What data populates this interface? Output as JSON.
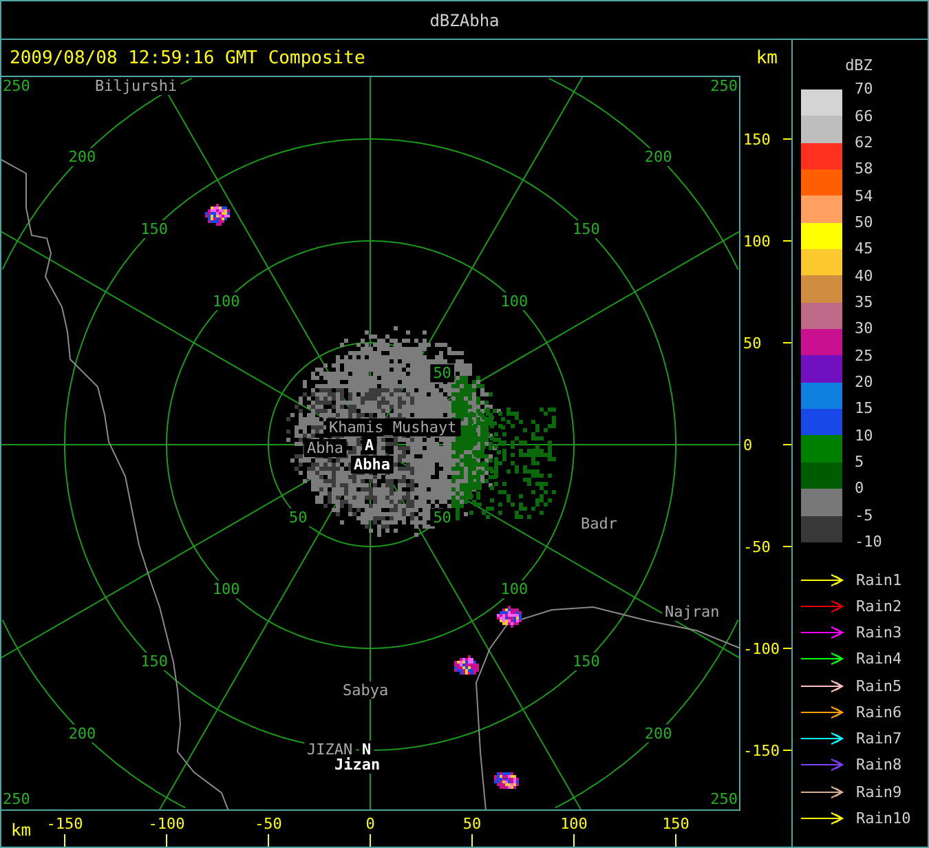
{
  "window": {
    "title": "dBZAbha"
  },
  "header": {
    "timestamp": "2009/08/08 12:59:16 GMT Composite",
    "unit": "km"
  },
  "range_rings": [
    {
      "labels": [
        "50",
        "50",
        "50"
      ]
    },
    {
      "labels": [
        "100",
        "100",
        "100",
        "100"
      ]
    },
    {
      "labels": [
        "150",
        "150",
        "150",
        "150"
      ]
    },
    {
      "labels": [
        "200",
        "200",
        "200",
        "200"
      ]
    },
    {
      "labels": [
        "250",
        "250",
        "250",
        "250"
      ]
    }
  ],
  "places": [
    {
      "name": "Biljurshi",
      "kind": "town"
    },
    {
      "name": "Khamis_Mushayt",
      "kind": "town"
    },
    {
      "name": "Abha",
      "kind": "town"
    },
    {
      "name": "A",
      "kind": "marker"
    },
    {
      "name": "Abha",
      "kind": "site"
    },
    {
      "name": "Badr",
      "kind": "town"
    },
    {
      "name": "Najran",
      "kind": "town"
    },
    {
      "name": "Sabya",
      "kind": "town"
    },
    {
      "name": "JIZAN",
      "kind": "town"
    },
    {
      "name": "N",
      "kind": "marker"
    },
    {
      "name": "Jizan",
      "kind": "site"
    }
  ],
  "y_axis": {
    "ticks": [
      "150",
      "100",
      "50",
      "0",
      "-50",
      "-100",
      "-150"
    ]
  },
  "x_axis": {
    "unit": "km",
    "ticks": [
      "-150",
      "-100",
      "-50",
      "0",
      "50",
      "100",
      "150"
    ]
  },
  "scale": {
    "title": "dBZ",
    "bins": [
      {
        "color": "#d4d4d4"
      },
      {
        "color": "#bebebe"
      },
      {
        "color": "#ff3020"
      },
      {
        "color": "#ff5f00"
      },
      {
        "color": "#ff9f60"
      },
      {
        "color": "#ffff00"
      },
      {
        "color": "#fcc830"
      },
      {
        "color": "#d08c40"
      },
      {
        "color": "#c06a8a"
      },
      {
        "color": "#c81090"
      },
      {
        "color": "#7010c0"
      },
      {
        "color": "#1080e0"
      },
      {
        "color": "#1848e8"
      },
      {
        "color": "#008000"
      },
      {
        "color": "#005c00"
      },
      {
        "color": "#787878"
      },
      {
        "color": "#383838"
      }
    ],
    "labels": [
      "70",
      "66",
      "62",
      "58",
      "54",
      "50",
      "45",
      "40",
      "35",
      "30",
      "25",
      "20",
      "15",
      "10",
      "5",
      "0",
      "-5",
      "-10"
    ]
  },
  "tracks": [
    {
      "label": "Rain1",
      "color": "#ffff00"
    },
    {
      "label": "Rain2",
      "color": "#e00000"
    },
    {
      "label": "Rain3",
      "color": "#ff00ff"
    },
    {
      "label": "Rain4",
      "color": "#00ff00"
    },
    {
      "label": "Rain5",
      "color": "#ffc0c0"
    },
    {
      "label": "Rain6",
      "color": "#ffa000"
    },
    {
      "label": "Rain7",
      "color": "#00ffff"
    },
    {
      "label": "Rain8",
      "color": "#8040ff"
    },
    {
      "label": "Rain9",
      "color": "#d8b090"
    },
    {
      "label": "Rain10",
      "color": "#ffff00"
    }
  ]
}
